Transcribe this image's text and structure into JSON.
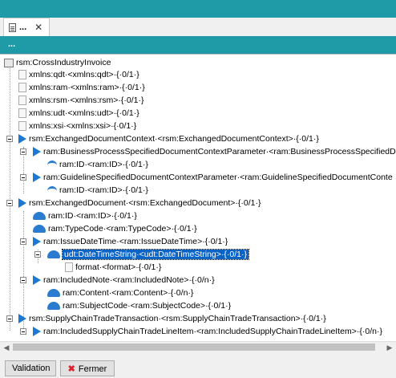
{
  "tab": {
    "title": "...",
    "close": "✕"
  },
  "strip": {
    "label": "..."
  },
  "tree": {
    "root": "rsm:CrossIndustryInvoice",
    "rows": [
      "xmlns:qdt·<xmlns:qdt>·{·0/1·}",
      "xmlns:ram·<xmlns:ram>·{·0/1·}",
      "xmlns:rsm·<xmlns:rsm>·{·0/1·}",
      "xmlns:udt·<xmlns:udt>·{·0/1·}",
      "xmlns:xsi·<xmlns:xsi>·{·0/1·}",
      "rsm:ExchangedDocumentContext·<rsm:ExchangedDocumentContext>·{·0/1·}",
      "ram:BusinessProcessSpecifiedDocumentContextParameter·<ram:BusinessProcessSpecifiedD",
      "ram:ID·<ram:ID>·{·0/1·}",
      "ram:GuidelineSpecifiedDocumentContextParameter·<ram:GuidelineSpecifiedDocumentConte",
      "ram:ID·<ram:ID>·{·0/1·}",
      "rsm:ExchangedDocument·<rsm:ExchangedDocument>·{·0/1·}",
      "ram:ID·<ram:ID>·{·0/1·}",
      "ram:TypeCode·<ram:TypeCode>·{·0/1·}",
      "ram:IssueDateTime·<ram:IssueDateTime>·{·0/1·}",
      "udt:DateTimeString·<udt:DateTimeString>·{·0/1·}",
      "format·<format>·{·0/1·}",
      "ram:IncludedNote·<ram:IncludedNote>·{·0/n·}",
      "ram:Content·<ram:Content>·{·0/n·}",
      "ram:SubjectCode·<ram:SubjectCode>·{·0/1·}",
      "rsm:SupplyChainTradeTransaction·<rsm:SupplyChainTradeTransaction>·{·0/1·}",
      "ram:IncludedSupplyChainTradeLineItem·<ram:IncludedSupplyChainTradeLineItem>·{·0/n·}"
    ]
  },
  "scroll": {
    "left": "◀",
    "right": "▶"
  },
  "buttons": {
    "validation": "Validation",
    "fermer": "Fermer",
    "fermer_icon": "✖"
  },
  "colors": {
    "accent": "#1f9aa7",
    "selection": "#0a64c8",
    "node_icon": "#1b79d4"
  }
}
